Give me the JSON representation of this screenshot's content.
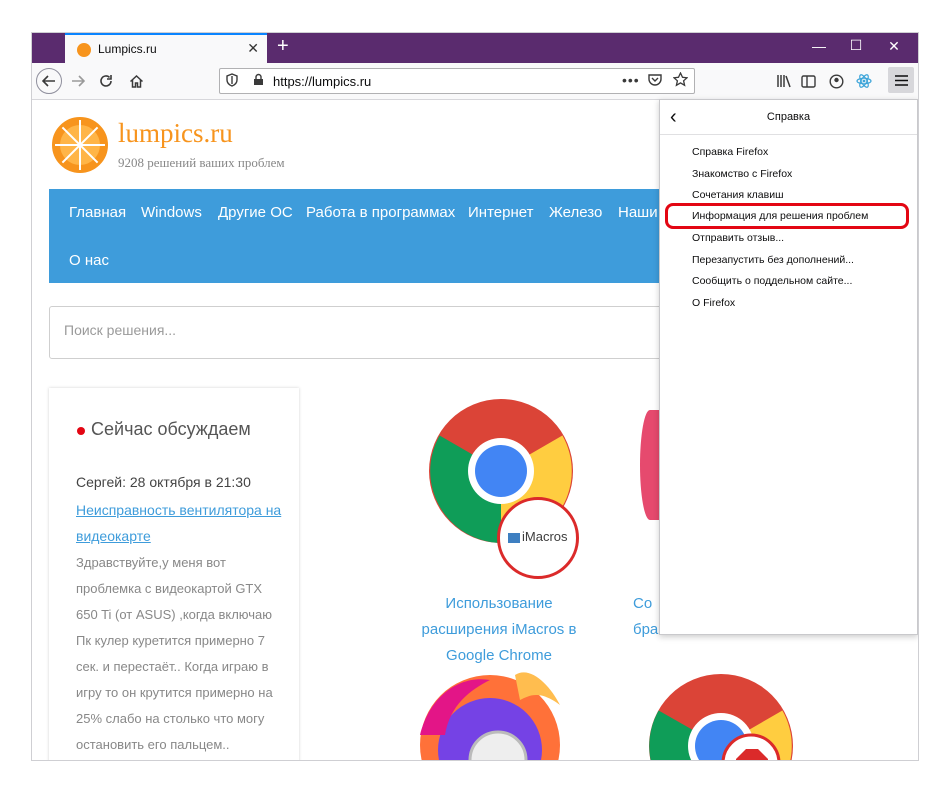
{
  "browser": {
    "tab_title": "Lumpics.ru",
    "tab_close": "✕",
    "new_tab": "+",
    "minimize": "—",
    "maximize": "☐",
    "close": "✕",
    "url": "https://lumpics.ru",
    "page_actions": "•••"
  },
  "site": {
    "name": "lumpics.ru",
    "tagline": "9208 решений ваших проблем",
    "nav": [
      "Главная",
      "Windows",
      "Другие ОС",
      "Работа в программах",
      "Интернет",
      "Железо",
      "Наши",
      "О нас"
    ],
    "search_placeholder": "Поиск решения..."
  },
  "sidebar": {
    "heading": "Сейчас обсуждаем",
    "author": "Сергей: 28 октября в 21:30",
    "link": "Неисправность вентилятора на видеокарте",
    "comment": "Здравствуйте,у меня вот проблемка с видеокартой GTX 650 Ti (от ASUS) ,когда включаю Пк кулер куретится примерно 7 сек. и перестаёт.. Когда играю в игру то он крутится примерно на 25% слабо на столько что могу остановить его пальцем.."
  },
  "articles": [
    {
      "title": "Использование расширения iMacros в Google Chrome",
      "badge": "iMacros"
    },
    {
      "title": "Со бра"
    }
  ],
  "menu": {
    "title": "Справка",
    "back": "‹",
    "items": [
      "Справка Firefox",
      "Знакомство с Firefox",
      "Сочетания клавиш",
      "Информация для решения проблем",
      "Отправить отзыв...",
      "Перезапустить без дополнений...",
      "Сообщить о поддельном сайте...",
      "О Firefox"
    ]
  },
  "colors": {
    "titlebar": "#5a2b6e",
    "nav_bg": "#3e9cdb",
    "brand_orange": "#f7941d",
    "highlight_red": "#e30613"
  }
}
